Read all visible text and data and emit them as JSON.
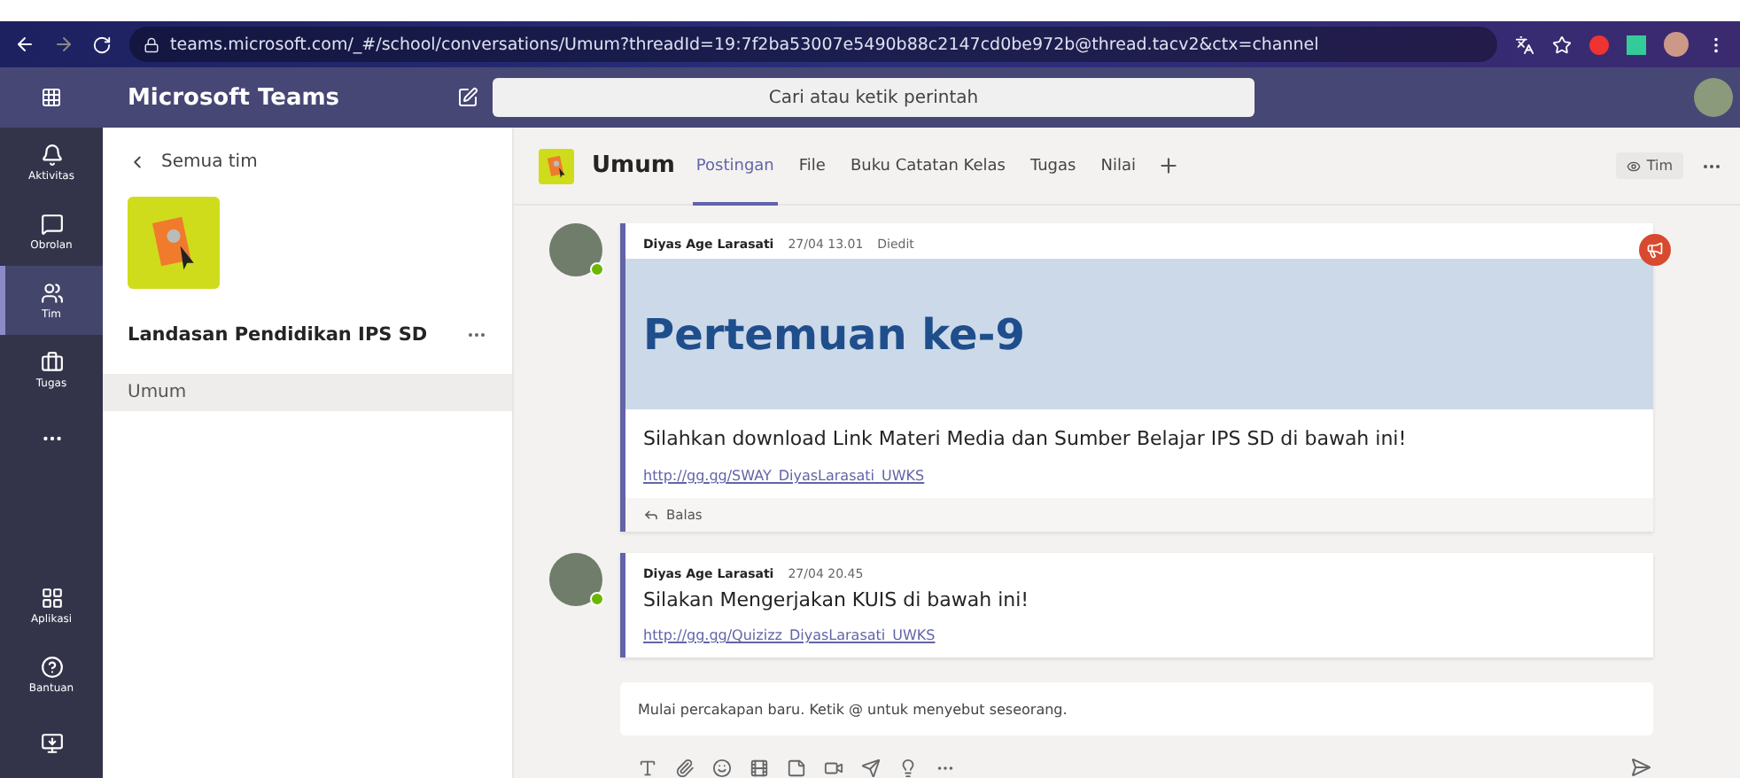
{
  "browser": {
    "url": "teams.microsoft.com/_#/school/conversations/Umum?threadId=19:7f2ba53007e5490b88c2147cd0be972b@thread.tacv2&ctx=channel"
  },
  "app_bar": {
    "title": "Microsoft Teams",
    "search_placeholder": "Cari atau ketik perintah"
  },
  "rail": {
    "items": [
      {
        "label": "Aktivitas",
        "kind": "bell",
        "selected": false
      },
      {
        "label": "Obrolan",
        "kind": "chat",
        "selected": false
      },
      {
        "label": "Tim",
        "kind": "teams",
        "selected": true
      },
      {
        "label": "Tugas",
        "kind": "bag",
        "selected": false
      },
      {
        "kind": "more",
        "selected": false
      }
    ],
    "bottom": [
      {
        "label": "Aplikasi",
        "kind": "apps"
      },
      {
        "label": "Bantuan",
        "kind": "help"
      },
      {
        "kind": "download"
      }
    ]
  },
  "team_panel": {
    "back_label": "Semua tim",
    "team_name": "Landasan Pendidikan IPS SD",
    "channels": [
      {
        "name": "Umum",
        "selected": true
      }
    ]
  },
  "channel": {
    "name": "Umum",
    "tabs": [
      {
        "label": "Postingan",
        "selected": true
      },
      {
        "label": "File",
        "selected": false
      },
      {
        "label": "Buku Catatan Kelas",
        "selected": false
      },
      {
        "label": "Tugas",
        "selected": false
      },
      {
        "label": "Nilai",
        "selected": false
      }
    ],
    "team_button": "Tim"
  },
  "posts": [
    {
      "kind": "announcement",
      "author": "Diyas Age Larasati",
      "time": "27/04 13.01",
      "edited": "Diedit",
      "banner_title": "Pertemuan ke-9",
      "text": "Silahkan download Link Materi Media dan Sumber Belajar IPS SD di bawah ini!",
      "link": "http://gg.gg/SWAY_DiyasLarasati_UWKS",
      "reply_label": "Balas"
    },
    {
      "kind": "message",
      "author": "Diyas Age Larasati",
      "time": "27/04 20.45",
      "text": "Silakan Mengerjakan KUIS di bawah ini!",
      "link": "http://gg.gg/Quizizz_DiyasLarasati_UWKS"
    }
  ],
  "compose": {
    "placeholder": "Mulai percakapan baru. Ketik @ untuk menyebut seseorang."
  }
}
